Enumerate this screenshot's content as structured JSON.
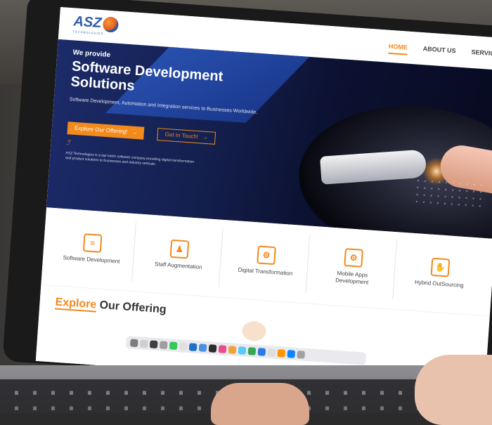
{
  "header": {
    "logo_text": "ASZ",
    "logo_tagline": "TECHNOLOGIES",
    "nav": [
      {
        "label": "HOME",
        "active": true
      },
      {
        "label": "ABOUT US",
        "active": false
      },
      {
        "label": "SERVICES",
        "active": false,
        "caret": "▾"
      }
    ]
  },
  "hero": {
    "eyebrow": "We provide",
    "title": "Software Development Solutions",
    "description": "Software Development, Automation and Integration services to Businesses Worldwide.",
    "primary_button": "Explore Our Offering!",
    "secondary_button": "Get In Touch!",
    "button_arrow": "→",
    "signature": "ℐ",
    "about": "ASZ Technologies is a top-notch software company providing digital transformation and product solutions to businesses and industry verticals."
  },
  "services": [
    {
      "label": "Software Development",
      "icon": "code-window-icon"
    },
    {
      "label": "Staff Augmentation",
      "icon": "team-icon"
    },
    {
      "label": "Digital Transformation",
      "icon": "mobile-gear-icon"
    },
    {
      "label": "Mobile Apps Development",
      "icon": "app-gear-icon"
    },
    {
      "label": "Hybrid OutSourcing",
      "icon": "handshake-icon"
    }
  ],
  "explore": {
    "accent": "Explore",
    "rest": " Our Offering"
  },
  "colors": {
    "accent": "#f28a1c",
    "brand_blue": "#2d5ca8",
    "hero_dark": "#0c1131"
  }
}
